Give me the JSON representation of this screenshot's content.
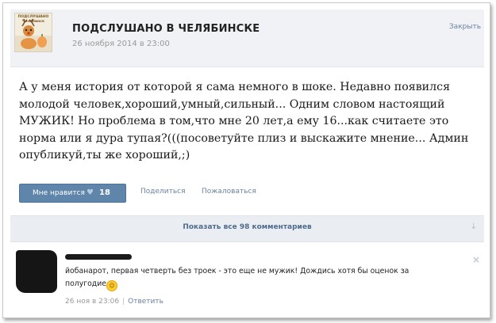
{
  "post": {
    "logo_text_top": "ПОДСЛУШАНО",
    "logo_text_bottom": "Челябинск",
    "group_name": "ПОДСЛУШАНО В ЧЕЛЯБИНСКЕ",
    "date": "26 ноября 2014 в 23:00",
    "close_label": "Закрыть",
    "text": "А у меня история от которой я сама немного в шоке. Недавно появился молодой человек,хороший,умный,сильный... Одним словом настоящий МУЖИК! Но проблема в том,что мне 20 лет,а ему 16...как считаете это норма или я дура тупая?(((посоветуйте плиз и выскажите мнение... Админ опубликуй,ты же хороший,;)"
  },
  "actions": {
    "like_label": "Мне нравится",
    "heart_icon": "♥",
    "like_count": "18",
    "share_label": "Поделиться",
    "report_label": "Пожаловаться"
  },
  "comments_bar": {
    "label": "Показать все 98 комментариев",
    "arrow_icon": "↓"
  },
  "comment": {
    "text": "йобанарот, первая четверть без троек - это еще не мужик! Дождись хотя бы оценок за полугодие",
    "emoji": "☺",
    "date": "26 ноя в 23:06",
    "separator": "|",
    "reply_label": "Ответить",
    "close_icon": "×"
  }
}
